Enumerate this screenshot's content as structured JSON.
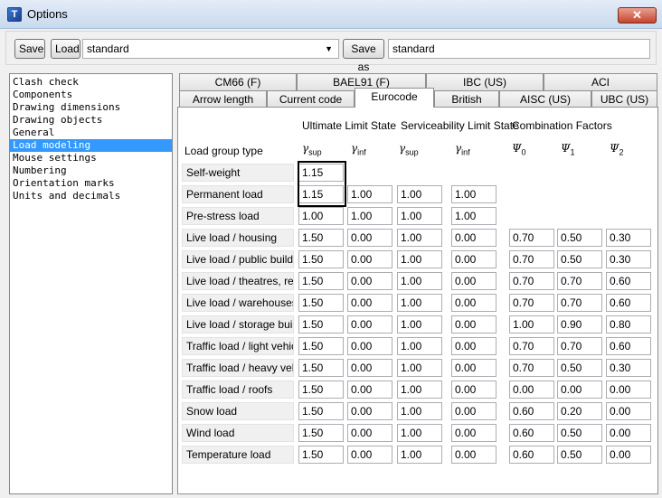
{
  "window": {
    "title": "Options",
    "close_label": "✕"
  },
  "toolbar": {
    "save_label": "Save",
    "load_label": "Load",
    "settings_value": "standard",
    "save_as_label": "Save as",
    "save_as_value": "standard"
  },
  "sidebar": {
    "items": [
      "Clash check",
      "Components",
      "Drawing dimensions",
      "Drawing objects",
      "General",
      "Load modeling",
      "Mouse settings",
      "Numbering",
      "Orientation marks",
      "Units and decimals"
    ],
    "selected": "Load modeling"
  },
  "tabs": {
    "row1": [
      "CM66 (F)",
      "BAEL91 (F)",
      "IBC (US)",
      "ACI"
    ],
    "row2": [
      "Arrow length",
      "Current code",
      "Eurocode",
      "British",
      "AISC (US)",
      "UBC (US)"
    ],
    "active": "Eurocode"
  },
  "eurocode": {
    "group_uls": "Ultimate Limit State",
    "group_sls": "Serviceability Limit State",
    "group_cf": "Combination Factors",
    "load_group_type_label": "Load group type",
    "columns": [
      {
        "base": "γ",
        "sub": "sup"
      },
      {
        "base": "γ",
        "sub": "inf"
      },
      {
        "base": "γ",
        "sub": "sup"
      },
      {
        "base": "γ",
        "sub": "inf"
      },
      {
        "base": "Ψ",
        "sub": "0"
      },
      {
        "base": "Ψ",
        "sub": "1"
      },
      {
        "base": "Ψ",
        "sub": "2"
      }
    ],
    "rows": [
      {
        "label": "Self-weight",
        "values": [
          "1.15",
          "",
          "",
          "",
          "",
          "",
          ""
        ]
      },
      {
        "label": "Permanent load",
        "values": [
          "1.15",
          "1.00",
          "1.00",
          "1.00",
          "",
          "",
          ""
        ]
      },
      {
        "label": "Pre-stress load",
        "values": [
          "1.00",
          "1.00",
          "1.00",
          "1.00",
          "",
          "",
          ""
        ]
      },
      {
        "label": "Live load / housing",
        "values": [
          "1.50",
          "0.00",
          "1.00",
          "0.00",
          "0.70",
          "0.50",
          "0.30"
        ]
      },
      {
        "label": "Live load / public building",
        "values": [
          "1.50",
          "0.00",
          "1.00",
          "0.00",
          "0.70",
          "0.50",
          "0.30"
        ]
      },
      {
        "label": "Live load / theatres, resta",
        "values": [
          "1.50",
          "0.00",
          "1.00",
          "0.00",
          "0.70",
          "0.70",
          "0.60"
        ]
      },
      {
        "label": "Live load / warehouses",
        "values": [
          "1.50",
          "0.00",
          "1.00",
          "0.00",
          "0.70",
          "0.70",
          "0.60"
        ]
      },
      {
        "label": "Live load / storage buildir",
        "values": [
          "1.50",
          "0.00",
          "1.00",
          "0.00",
          "1.00",
          "0.90",
          "0.80"
        ]
      },
      {
        "label": "Traffic load / light vehicle",
        "values": [
          "1.50",
          "0.00",
          "1.00",
          "0.00",
          "0.70",
          "0.70",
          "0.60"
        ]
      },
      {
        "label": "Traffic load / heavy vehic",
        "values": [
          "1.50",
          "0.00",
          "1.00",
          "0.00",
          "0.70",
          "0.50",
          "0.30"
        ]
      },
      {
        "label": "Traffic load / roofs",
        "values": [
          "1.50",
          "0.00",
          "1.00",
          "0.00",
          "0.00",
          "0.00",
          "0.00"
        ]
      },
      {
        "label": "Snow load",
        "values": [
          "1.50",
          "0.00",
          "1.00",
          "0.00",
          "0.60",
          "0.20",
          "0.00"
        ]
      },
      {
        "label": "Wind load",
        "values": [
          "1.50",
          "0.00",
          "1.00",
          "0.00",
          "0.60",
          "0.50",
          "0.00"
        ]
      },
      {
        "label": "Temperature load",
        "values": [
          "1.50",
          "0.00",
          "1.00",
          "0.00",
          "0.60",
          "0.50",
          "0.00"
        ]
      }
    ]
  }
}
